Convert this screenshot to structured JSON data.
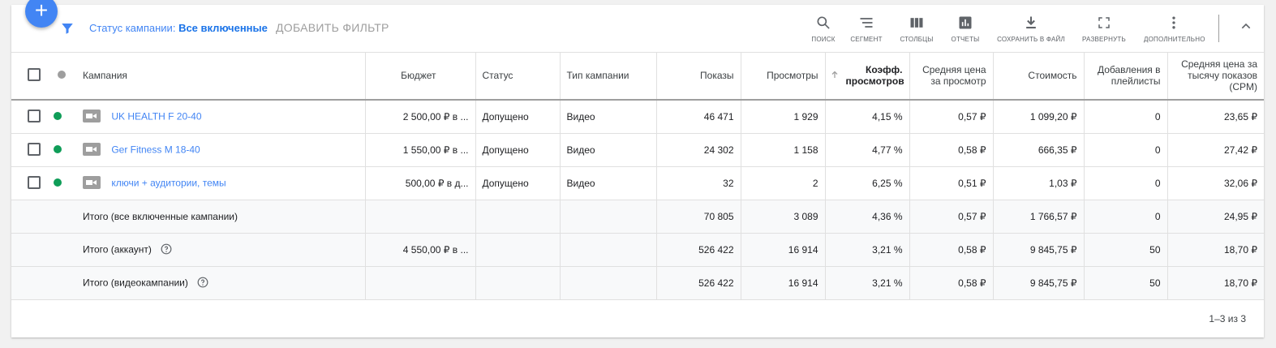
{
  "fab": {
    "label": "+"
  },
  "filter": {
    "label": "Статус кампании:",
    "value": "Все включенные",
    "add_filter": "ДОБАВИТЬ ФИЛЬТР"
  },
  "toolbar": {
    "search": "ПОИСК",
    "segment": "СЕГМЕНТ",
    "columns": "СТОЛБЦЫ",
    "reports": "ОТЧЕТЫ",
    "save": "СОХРАНИТЬ В ФАЙЛ",
    "expand": "РАЗВЕРНУТЬ",
    "more": "ДОПОЛНИТЕЛЬНО"
  },
  "headers": {
    "campaign": "Кампания",
    "budget": "Бюджет",
    "status": "Статус",
    "type": "Тип кампании",
    "impressions": "Показы",
    "views": "Просмотры",
    "view_rate": "Коэфф. просмотров",
    "avg_cpv": "Средняя цена за просмотр",
    "cost": "Стоимость",
    "playlist_adds": "Добавления в плейлисты",
    "cpm": "Средняя цена за тысячу показов (CPM)"
  },
  "rows": [
    {
      "name": "UK HEALTH F 20-40",
      "budget": "2 500,00 ₽ в ...",
      "status": "Допущено",
      "type": "Видео",
      "impressions": "46 471",
      "views": "1 929",
      "view_rate": "4,15 %",
      "avg_cpv": "0,57 ₽",
      "cost": "1 099,20 ₽",
      "playlist_adds": "0",
      "cpm": "23,65 ₽"
    },
    {
      "name": "Ger Fitness M 18-40",
      "budget": "1 550,00 ₽ в ...",
      "status": "Допущено",
      "type": "Видео",
      "impressions": "24 302",
      "views": "1 158",
      "view_rate": "4,77 %",
      "avg_cpv": "0,58 ₽",
      "cost": "666,35 ₽",
      "playlist_adds": "0",
      "cpm": "27,42 ₽"
    },
    {
      "name": "ключи + аудитории, темы",
      "budget": "500,00 ₽ в д...",
      "status": "Допущено",
      "type": "Видео",
      "impressions": "32",
      "views": "2",
      "view_rate": "6,25 %",
      "avg_cpv": "0,51 ₽",
      "cost": "1,03 ₽",
      "playlist_adds": "0",
      "cpm": "32,06 ₽"
    }
  ],
  "totals": [
    {
      "name": "Итого (все включенные кампании)",
      "budget": "",
      "impressions": "70 805",
      "views": "3 089",
      "view_rate": "4,36 %",
      "avg_cpv": "0,57 ₽",
      "cost": "1 766,57 ₽",
      "playlist_adds": "0",
      "cpm": "24,95 ₽"
    },
    {
      "name": "Итого (аккаунт)",
      "budget": "4 550,00 ₽ в ...",
      "impressions": "526 422",
      "views": "16 914",
      "view_rate": "3,21 %",
      "avg_cpv": "0,58 ₽",
      "cost": "9 845,75 ₽",
      "playlist_adds": "50",
      "cpm": "18,70 ₽"
    },
    {
      "name": "Итого (видеокампании)",
      "budget": "",
      "impressions": "526 422",
      "views": "16 914",
      "view_rate": "3,21 %",
      "avg_cpv": "0,58 ₽",
      "cost": "9 845,75 ₽",
      "playlist_adds": "50",
      "cpm": "18,70 ₽"
    }
  ],
  "pagination": "1–3 из 3",
  "colors": {
    "accent": "#4285f4",
    "enabled": "#0f9d58"
  }
}
